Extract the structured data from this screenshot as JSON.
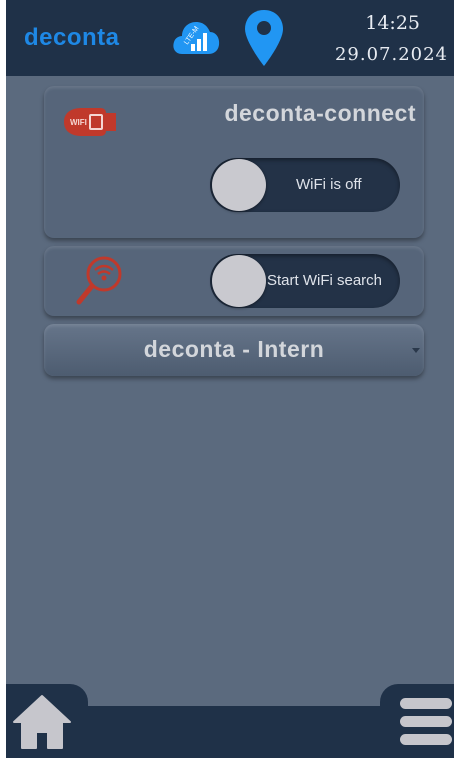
{
  "header": {
    "brand": "deconta",
    "cloud_icon": "cloud-lte-signal-icon",
    "cloud_icon_text": "LTE-M",
    "location_icon": "location-pin-icon",
    "time": "14:25",
    "date": "29.07.2024"
  },
  "connect_card": {
    "title": "deconta-connect",
    "icon": "wifi-connector-icon",
    "icon_text": "WIFI",
    "toggle_label": "WiFi is off",
    "toggle_on": false
  },
  "search_card": {
    "icon": "wifi-search-icon",
    "toggle_label": "Start WiFi search",
    "toggle_on": false
  },
  "network_dropdown": {
    "selected": "deconta - Intern"
  },
  "footer": {
    "home_icon": "home-icon",
    "menu_icon": "hamburger-menu-icon"
  },
  "colors": {
    "background": "#5b6a7e",
    "header": "#1f3148",
    "brand": "#1e88e5",
    "accent_red": "#c0392b",
    "toggle_track": "#233247",
    "knob": "#c9c9cf"
  }
}
